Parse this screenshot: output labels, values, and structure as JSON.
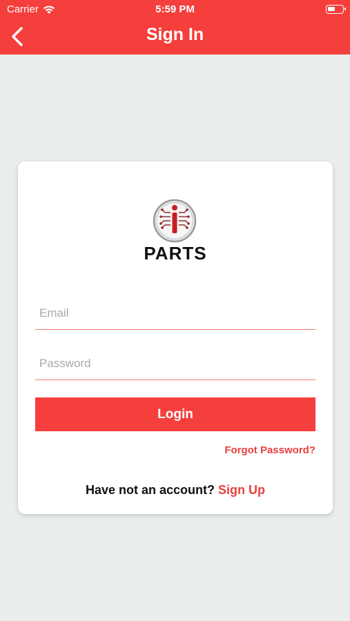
{
  "status_bar": {
    "carrier": "Carrier",
    "time": "5:59 PM",
    "wifi_icon": "wifi-icon",
    "battery_icon": "battery-icon"
  },
  "nav": {
    "title": "Sign In",
    "back_icon": "chevron-left-icon"
  },
  "logo": {
    "text": "PARTS",
    "badge_icon": "circuit-i-logo"
  },
  "form": {
    "email": {
      "value": "",
      "placeholder": "Email"
    },
    "password": {
      "value": "",
      "placeholder": "Password"
    },
    "login_label": "Login",
    "forgot_label": "Forgot Password?",
    "signup_prompt": "Have not an account?",
    "signup_label": "Sign Up"
  },
  "colors": {
    "brand_red": "#f53f3c",
    "background": "#e9eded",
    "field_underline": "#f27b78"
  }
}
